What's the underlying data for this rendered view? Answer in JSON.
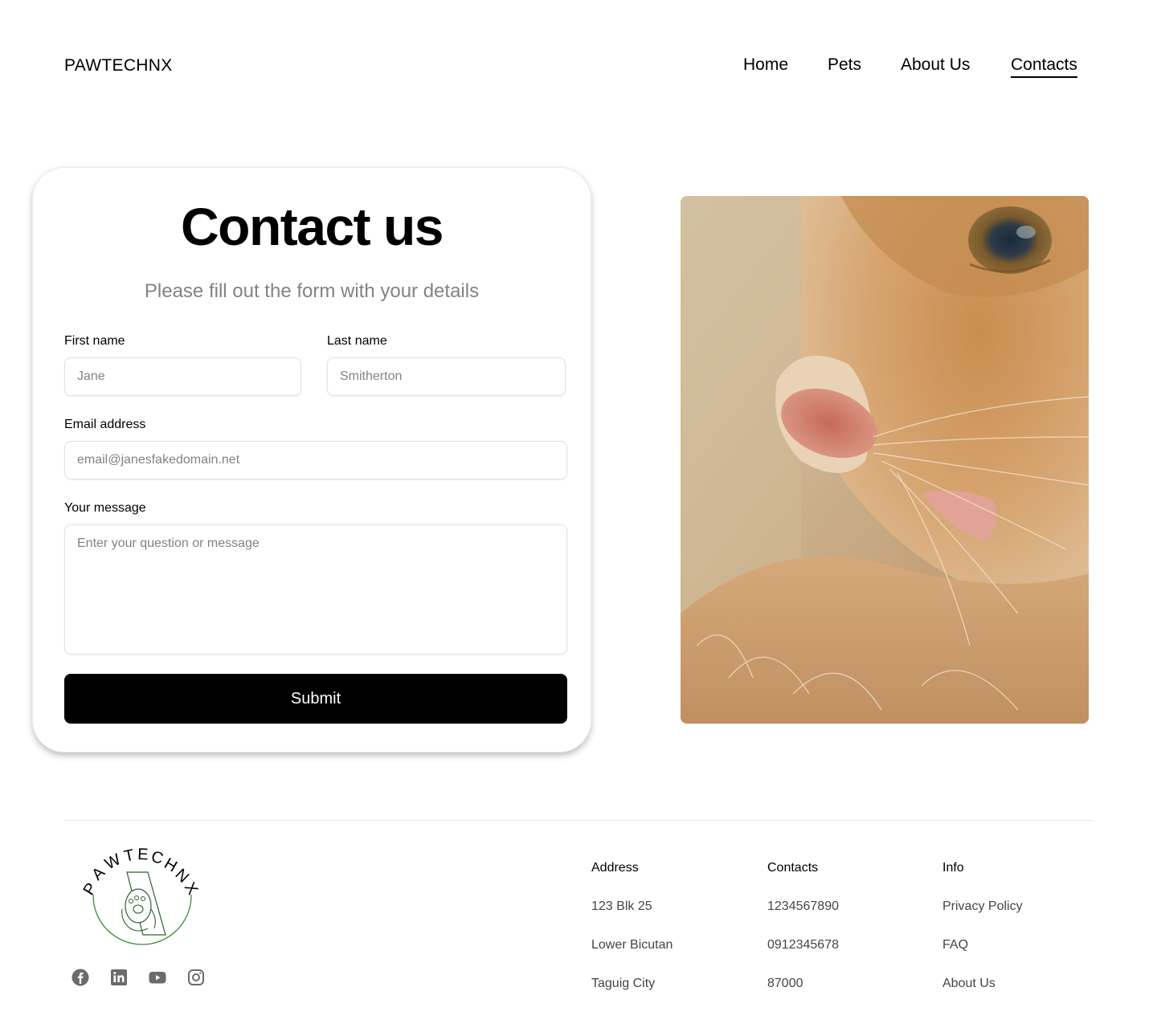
{
  "header": {
    "brand": "PAWTECHNX",
    "nav": [
      {
        "label": "Home",
        "active": false
      },
      {
        "label": "Pets",
        "active": false
      },
      {
        "label": "About Us",
        "active": false
      },
      {
        "label": "Contacts",
        "active": true
      }
    ]
  },
  "form": {
    "title": "Contact us",
    "subtitle": "Please fill out the form with your details",
    "first_name": {
      "label": "First name",
      "placeholder": "Jane",
      "value": ""
    },
    "last_name": {
      "label": "Last name",
      "placeholder": "Smitherton",
      "value": ""
    },
    "email": {
      "label": "Email address",
      "placeholder": "email@janesfakedomain.net",
      "value": ""
    },
    "message": {
      "label": "Your message",
      "placeholder": "Enter your question or message",
      "value": ""
    },
    "submit_label": "Submit"
  },
  "photo": {
    "subject": "close-up of orange tabby cat face"
  },
  "footer": {
    "logo_text": "PAWTECHNX",
    "social_icons": [
      "facebook-icon",
      "linkedin-icon",
      "youtube-icon",
      "instagram-icon"
    ],
    "columns": [
      {
        "title": "Address",
        "items": [
          "123 Blk 25",
          "Lower Bicutan",
          "Taguig City"
        ]
      },
      {
        "title": "Contacts",
        "items": [
          "1234567890",
          "0912345678",
          "87000"
        ]
      },
      {
        "title": "Info",
        "items": [
          "Privacy Policy",
          "FAQ",
          "About Us"
        ]
      }
    ]
  },
  "colors": {
    "accent": "#000000",
    "muted_text": "#828282",
    "logo_green": "#3a8a3a"
  }
}
